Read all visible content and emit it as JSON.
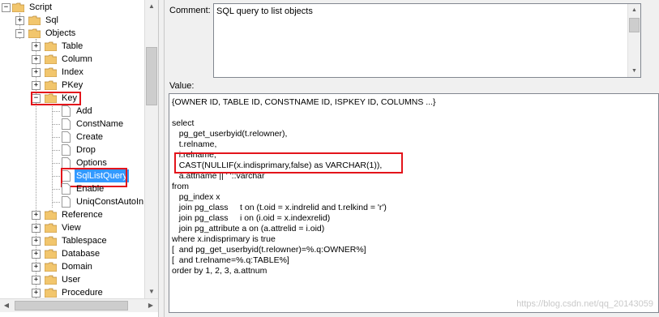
{
  "tree": {
    "items": [
      {
        "label": "Script",
        "icon": "folder-icon",
        "expander": "−"
      },
      {
        "label": "Sql",
        "icon": "folder-icon",
        "expander": "+"
      },
      {
        "label": "Objects",
        "icon": "folder-icon",
        "expander": "−"
      },
      {
        "label": "Table",
        "icon": "folder-icon",
        "expander": "+"
      },
      {
        "label": "Column",
        "icon": "folder-icon",
        "expander": "+"
      },
      {
        "label": "Index",
        "icon": "folder-icon",
        "expander": "+"
      },
      {
        "label": "PKey",
        "icon": "folder-icon",
        "expander": "+"
      },
      {
        "label": "Key",
        "icon": "folder-icon",
        "expander": "−"
      },
      {
        "label": "Add",
        "icon": "file-icon",
        "expander": ""
      },
      {
        "label": "ConstName",
        "icon": "file-icon",
        "expander": ""
      },
      {
        "label": "Create",
        "icon": "file-icon",
        "expander": ""
      },
      {
        "label": "Drop",
        "icon": "file-icon",
        "expander": ""
      },
      {
        "label": "Options",
        "icon": "file-icon",
        "expander": ""
      },
      {
        "label": "SqlListQuery",
        "icon": "file-icon",
        "expander": ""
      },
      {
        "label": "Enable",
        "icon": "file-icon",
        "expander": ""
      },
      {
        "label": "UniqConstAutoIn",
        "icon": "file-icon",
        "expander": ""
      },
      {
        "label": "Reference",
        "icon": "folder-icon",
        "expander": "+"
      },
      {
        "label": "View",
        "icon": "folder-icon",
        "expander": "+"
      },
      {
        "label": "Tablespace",
        "icon": "folder-icon",
        "expander": "+"
      },
      {
        "label": "Database",
        "icon": "folder-icon",
        "expander": "+"
      },
      {
        "label": "Domain",
        "icon": "folder-icon",
        "expander": "+"
      },
      {
        "label": "User",
        "icon": "folder-icon",
        "expander": "+"
      },
      {
        "label": "Procedure",
        "icon": "folder-icon",
        "expander": "+"
      }
    ],
    "selected": "SqlListQuery"
  },
  "comment": {
    "label": "Comment:",
    "value": "SQL query to list objects"
  },
  "value": {
    "label": "Value:",
    "lines": [
      "{OWNER ID, TABLE ID, CONSTNAME ID, ISPKEY ID, COLUMNS ...}",
      "",
      "select",
      "   pg_get_userbyid(t.relowner),",
      "   t.relname,",
      "   i.relname,",
      "   CAST(NULLIF(x.indisprimary,false) as VARCHAR(1)),",
      "   a.attname || ' '::varchar",
      "from",
      "   pg_index x",
      "   join pg_class     t on (t.oid = x.indrelid and t.relkind = 'r')",
      "   join pg_class     i on (i.oid = x.indexrelid)",
      "   join pg_attribute a on (a.attrelid = i.oid)",
      "where x.indisprimary is true",
      "[  and pg_get_userbyid(t.relowner)=%.q:OWNER%]",
      "[  and t.relname=%.q:TABLE%]",
      "order by 1, 2, 3, a.attnum"
    ]
  },
  "watermark": "https://blog.csdn.net/qq_20143059",
  "colors": {
    "highlight_box": "#e3141b",
    "selection": "#3399ff",
    "folder": "#f2c66d"
  }
}
